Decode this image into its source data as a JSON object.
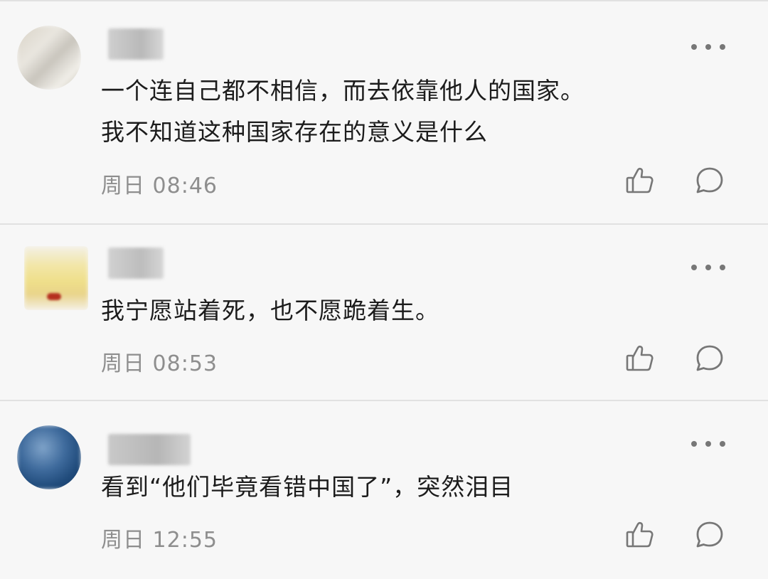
{
  "comments": [
    {
      "text": "一个连自己都不相信，而去依靠他人的国家。\n我不知道这种国家存在的意义是什么",
      "time": "周日 08:46"
    },
    {
      "text": "我宁愿站着死，也不愿跪着生。",
      "time": "周日 08:53"
    },
    {
      "text": "看到“他们毕竟看错中国了”，突然泪目",
      "time": "周日 12:55"
    }
  ],
  "icons": {
    "more": "more-dots-icon",
    "like": "thumbs-up-icon",
    "reply": "comment-bubble-icon"
  },
  "colors": {
    "background": "#f7f7f7",
    "divider": "#e1e1e1",
    "text": "#1c1c1c",
    "meta": "#8e8e8e",
    "icon": "#777777"
  }
}
